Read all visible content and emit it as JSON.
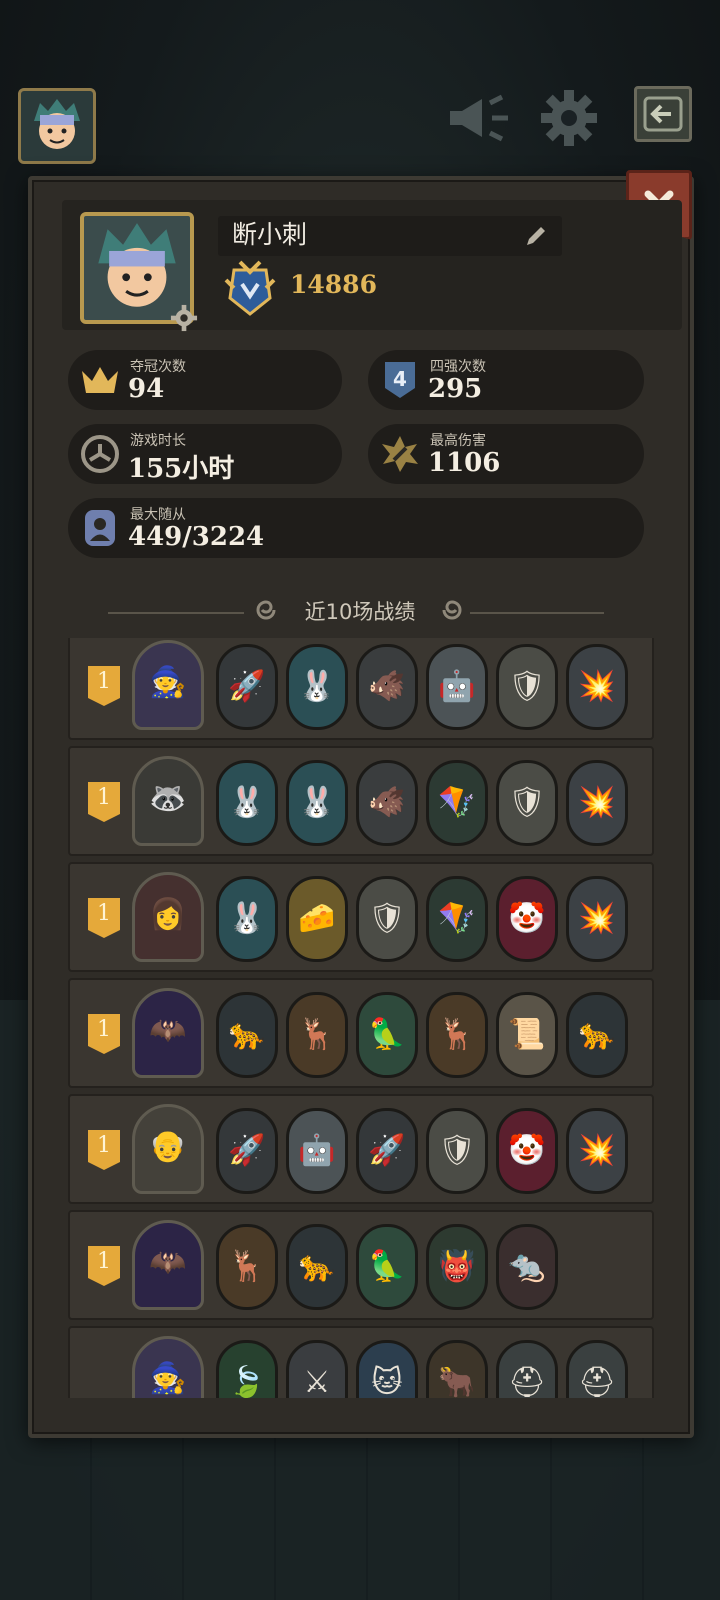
{
  "player": {
    "name": "断小刺",
    "rating": "14886"
  },
  "stats": [
    {
      "label": "夺冠次数",
      "value": "94",
      "icon": "crown-icon"
    },
    {
      "label": "四强次数",
      "value": "295",
      "icon": "top-four-shield-icon"
    },
    {
      "label": "游戏时长",
      "value": "155小时",
      "icon": "clock-icon"
    },
    {
      "label": "最高伤害",
      "value": "1106",
      "icon": "damage-burst-icon"
    },
    {
      "label": "最大随从",
      "value": "449/3224",
      "icon": "minion-portrait-icon"
    }
  ],
  "history": {
    "title": "近10场战绩",
    "matches": [
      {
        "place": "1",
        "hero": "wizard",
        "minions": [
          "rocket",
          "rabbit",
          "boar",
          "robot",
          "knight",
          "cannon"
        ]
      },
      {
        "place": "1",
        "hero": "raccoon",
        "minions": [
          "rabbit",
          "rabbit",
          "boar",
          "kite",
          "knight",
          "cannon"
        ]
      },
      {
        "place": "1",
        "hero": "lady",
        "minions": [
          "rabbit",
          "cheese-bot",
          "knight",
          "kite",
          "clown",
          "cannon"
        ]
      },
      {
        "place": "1",
        "hero": "bat",
        "minions": [
          "panther",
          "deer",
          "parrot",
          "deer",
          "scholar",
          "panther"
        ]
      },
      {
        "place": "1",
        "hero": "elder",
        "minions": [
          "rocket",
          "robot",
          "rocket",
          "knight",
          "clown",
          "cannon"
        ]
      },
      {
        "place": "1",
        "hero": "bat",
        "minions": [
          "deer",
          "panther",
          "parrot",
          "goblin",
          "rat"
        ]
      },
      {
        "place": "",
        "hero": "wizard",
        "minions": [
          "leaf",
          "blade",
          "cat",
          "horns",
          "helmet",
          "helmet"
        ]
      }
    ]
  },
  "colors": {
    "accent": "#e2b75a",
    "panel": "#2f2c27",
    "close": "#8a3b2c"
  }
}
